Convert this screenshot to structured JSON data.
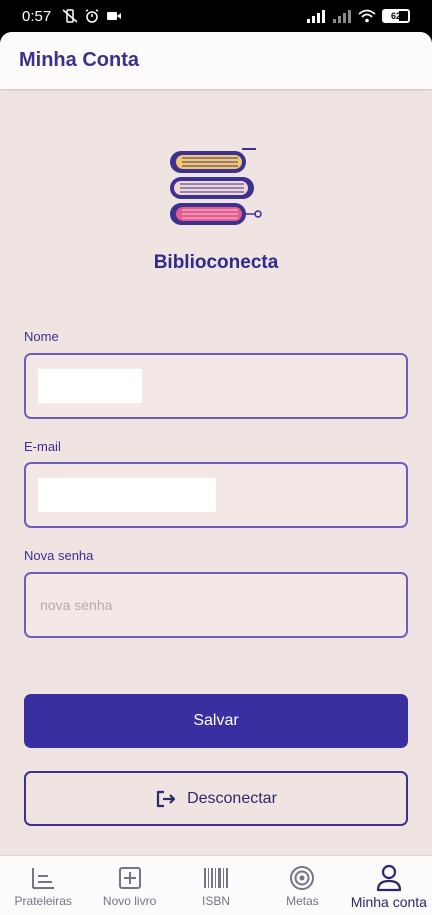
{
  "status_bar": {
    "time": "0:57",
    "battery": "62"
  },
  "app_bar": {
    "title": "Minha Conta"
  },
  "logo": {
    "brand": "Biblioconecta"
  },
  "form": {
    "name_label": "Nome",
    "email_label": "E-mail",
    "password_label": "Nova senha",
    "password_placeholder": "nova senha"
  },
  "buttons": {
    "save": "Salvar",
    "logout": "Desconectar"
  },
  "bottom_nav": [
    {
      "label": "Prateleiras",
      "icon": "shelves-icon"
    },
    {
      "label": "Novo livro",
      "icon": "add-book-icon"
    },
    {
      "label": "ISBN",
      "icon": "barcode-icon"
    },
    {
      "label": "Metas",
      "icon": "target-icon"
    },
    {
      "label": "Minha conta",
      "icon": "person-icon",
      "active": true
    }
  ],
  "colors": {
    "primary": "#3a2fa0",
    "background": "#efe4e2",
    "accent_text": "#3a3190"
  }
}
